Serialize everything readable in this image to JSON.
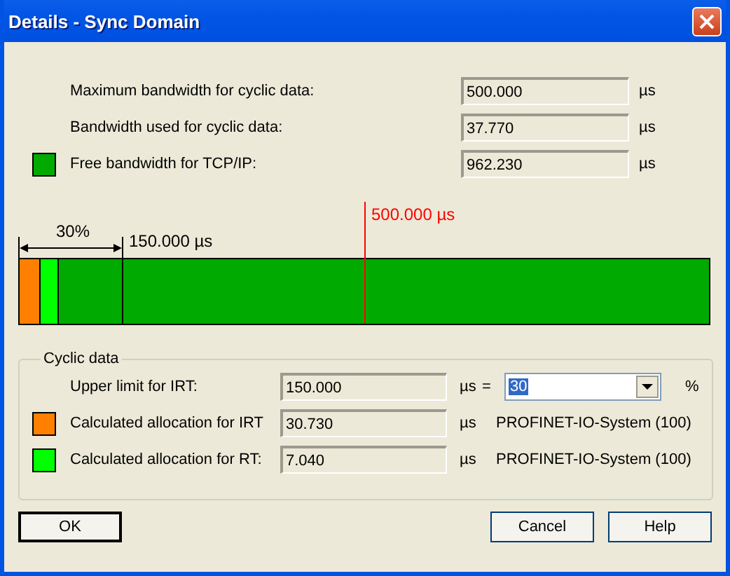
{
  "window": {
    "title": "Details - Sync Domain"
  },
  "bandwidth": [
    {
      "label": "Maximum bandwidth for cyclic data:",
      "value": "500.000",
      "unit": "µs"
    },
    {
      "label": "Bandwidth used for cyclic data:",
      "value": "37.770",
      "unit": "µs"
    },
    {
      "label": "Free bandwidth for TCP/IP:",
      "value": "962.230",
      "unit": "µs",
      "color": "#00aa00"
    }
  ],
  "diagram": {
    "percent": "30%",
    "limit": "150.000 µs",
    "maximum": "500.000 µs"
  },
  "cyclic_data": {
    "title": "Cyclic data",
    "upper_limit": {
      "label": "Upper limit for IRT:",
      "value": "150.000",
      "unit": "µs",
      "equals": "=",
      "percent_value": "30",
      "percent_unit": "%"
    },
    "allocations": [
      {
        "label": "Calculated allocation for IRT",
        "value": "30.730",
        "unit": "µs",
        "system": "PROFINET-IO-System (100)",
        "color": "#ff8000"
      },
      {
        "label": "Calculated allocation for RT:",
        "value": "7.040",
        "unit": "µs",
        "system": "PROFINET-IO-System (100)",
        "color": "#00ff00"
      }
    ]
  },
  "buttons": [
    "OK",
    "Cancel",
    "Help"
  ]
}
